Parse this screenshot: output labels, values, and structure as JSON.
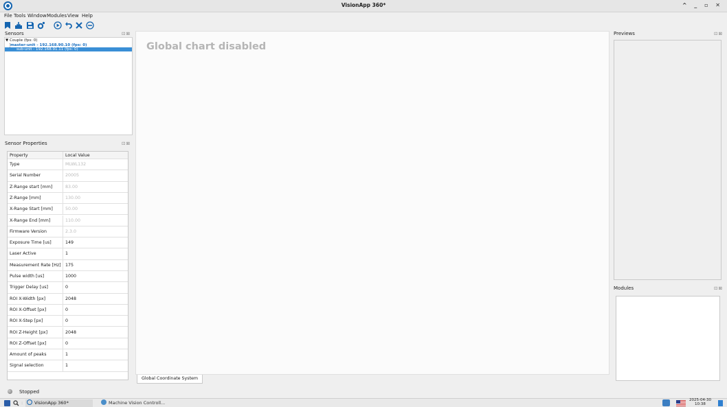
{
  "window": {
    "title": "VisionApp 360*",
    "controls": "^ _ ▫ ✕"
  },
  "menu": [
    "File",
    "Tools",
    "Window",
    "Modules",
    "View",
    "Help"
  ],
  "toolbar": {
    "icons": [
      "bookmark-icon",
      "import-icon",
      "save-icon",
      "settings-icon",
      "play-icon",
      "undo-icon",
      "tools-icon",
      "stop-icon"
    ]
  },
  "sensors": {
    "title": "Sensors",
    "dock_buttons": "⊡⊠",
    "tree": [
      {
        "label": "Couple (fps: 0)"
      },
      {
        "label": "master-unit - 192.168.90.10 (fps: 0)"
      },
      {
        "label": "sub-unit - 192.168.91.11 (fps: 0)"
      }
    ]
  },
  "properties": {
    "title": "Sensor Properties",
    "dock_buttons": "⊡⊠",
    "header": [
      "Property",
      "Local Value"
    ],
    "rows": [
      {
        "key": "Type",
        "value": "MLWL132",
        "readonly": true
      },
      {
        "key": "Serial Number",
        "value": "20005",
        "readonly": true
      },
      {
        "key": "Z-Range start [mm]",
        "value": "83.00",
        "readonly": true
      },
      {
        "key": "Z-Range [mm]",
        "value": "130.00",
        "readonly": true
      },
      {
        "key": "X-Range Start [mm]",
        "value": "50.00",
        "readonly": true
      },
      {
        "key": "X-Range End [mm]",
        "value": "110.00",
        "readonly": true
      },
      {
        "key": "Firmware Version",
        "value": "2.3.0",
        "readonly": true
      },
      {
        "key": "Exposure Time [us]",
        "value": "149",
        "readonly": false
      },
      {
        "key": "Laser Active",
        "value": "1",
        "readonly": false
      },
      {
        "key": "Measurement Rate [Hz]",
        "value": "175",
        "readonly": false
      },
      {
        "key": "Pulse width [us]",
        "value": "1000",
        "readonly": false
      },
      {
        "key": "Trigger Delay [us]",
        "value": "0",
        "readonly": false
      },
      {
        "key": "ROI X-Width [px]",
        "value": "2048",
        "readonly": false
      },
      {
        "key": "ROI X-Offset [px]",
        "value": "0",
        "readonly": false
      },
      {
        "key": "ROI X-Step [px]",
        "value": "0",
        "readonly": false
      },
      {
        "key": "ROI Z-Height [px]",
        "value": "2048",
        "readonly": false
      },
      {
        "key": "ROI Z-Offset [px]",
        "value": "0",
        "readonly": false
      },
      {
        "key": "Amount of peaks",
        "value": "1",
        "readonly": false
      },
      {
        "key": "Signal selection",
        "value": "1",
        "readonly": false
      }
    ]
  },
  "chart": {
    "message": "Global chart disabled",
    "tab": "Global Coordinate System"
  },
  "previews": {
    "title": "Previews",
    "dock_buttons": "⊡⊠"
  },
  "modules": {
    "title": "Modules",
    "dock_buttons": "⊡⊠"
  },
  "status": {
    "text": "Stopped"
  },
  "taskbar": {
    "tasks": [
      "VisionApp 360*",
      "Machine Vision Controll..."
    ],
    "clock_date": "2025-04-30",
    "clock_time": "10:38"
  },
  "colors": {
    "accent": "#1565b0",
    "selection": "#3a8fd6",
    "readonly_text": "#b9b9b9"
  }
}
